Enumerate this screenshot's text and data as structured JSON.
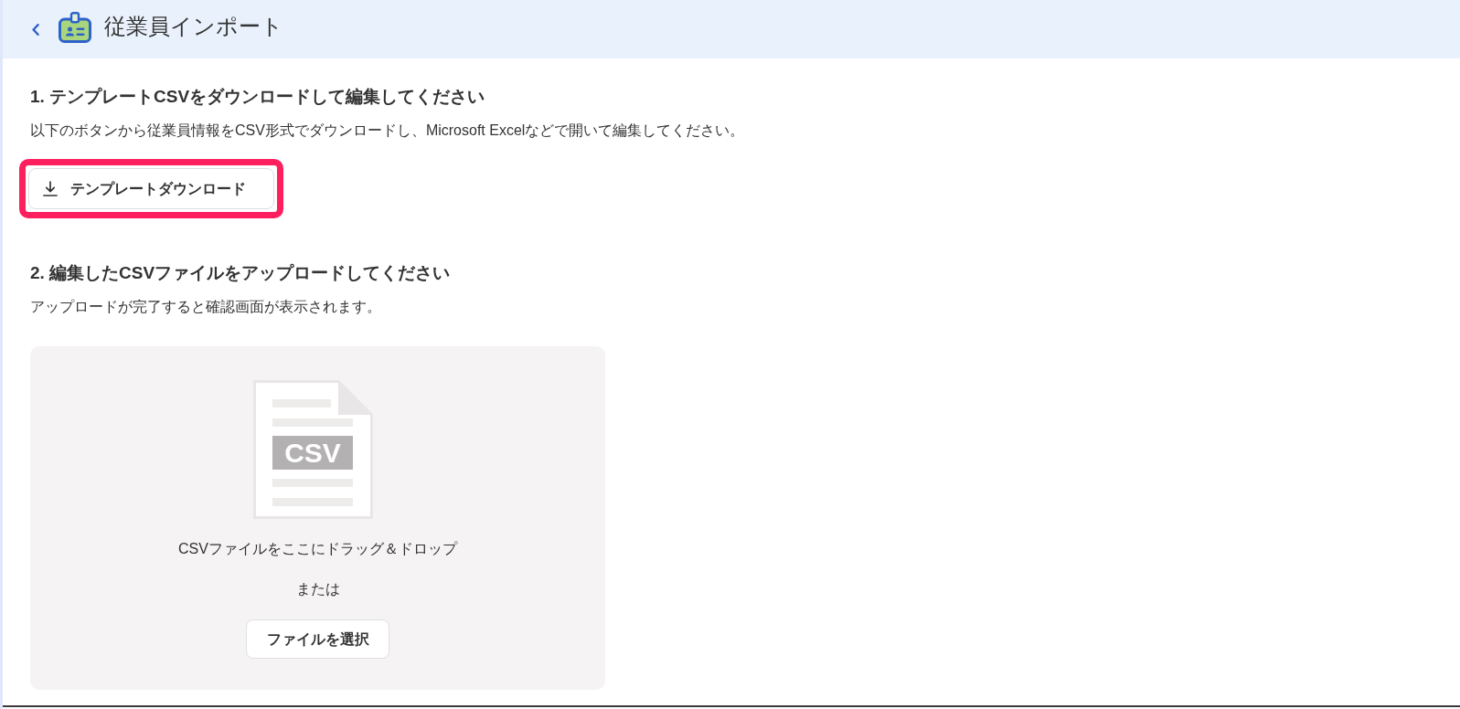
{
  "header": {
    "title": "従業員インポート"
  },
  "steps": [
    {
      "kind": "download",
      "heading": "1. テンプレートCSVをダウンロードして編集してください",
      "description": "以下のボタンから従業員情報をCSV形式でダウンロードし、Microsoft Excelなどで開いて編集してください。",
      "button": {
        "label": "テンプレートダウンロード",
        "highlighted": true
      }
    },
    {
      "kind": "upload",
      "heading": "2. 編集したCSVファイルをアップロードしてください",
      "description": "アップロードが完了すると確認画面が表示されます。",
      "dropzone": {
        "file_type": "CSV",
        "prompt": "CSVファイルをここにドラッグ＆ドロップ",
        "separator": "または",
        "button": {
          "label": "ファイルを選択"
        }
      }
    }
  ]
}
